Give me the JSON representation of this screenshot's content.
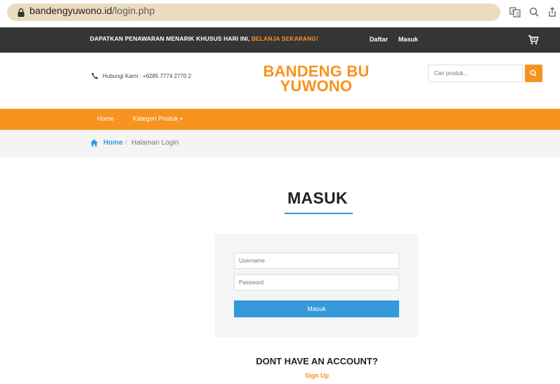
{
  "browser": {
    "url_domain": "bandengyuwono.id",
    "url_path": "/login.php",
    "icons": [
      "lock-icon",
      "translate-icon",
      "zoom-icon",
      "share-icon"
    ]
  },
  "topbar": {
    "promo_text": "DAPATKAN PENAWARAN MENARIK KHUSUS HARI INI, ",
    "promo_highlight": "BELANJA SEKARANG!",
    "register_label": "Daftar",
    "login_label": "Masuk"
  },
  "header": {
    "phone_text": "Hubungi Kami : +6285 7774 2770 2",
    "logo_line1": "BANDENG BU",
    "logo_line2": "YUWONO",
    "search_placeholder": "Cari produk..."
  },
  "nav": {
    "items": [
      {
        "label": "Home"
      },
      {
        "label": "Kategori Produk"
      }
    ]
  },
  "breadcrumb": {
    "home": "Home",
    "separator": "/",
    "current": "Halaman Login"
  },
  "login": {
    "title": "MASUK",
    "username_placeholder": "Username",
    "password_placeholder": "Password",
    "submit_label": "Masuk"
  },
  "signup": {
    "prompt": "DONT HAVE AN ACCOUNT?",
    "link_label": "Sign Up"
  },
  "colors": {
    "accent": "#f7931e",
    "primary": "#3498db",
    "topbar_bg": "#353535"
  }
}
